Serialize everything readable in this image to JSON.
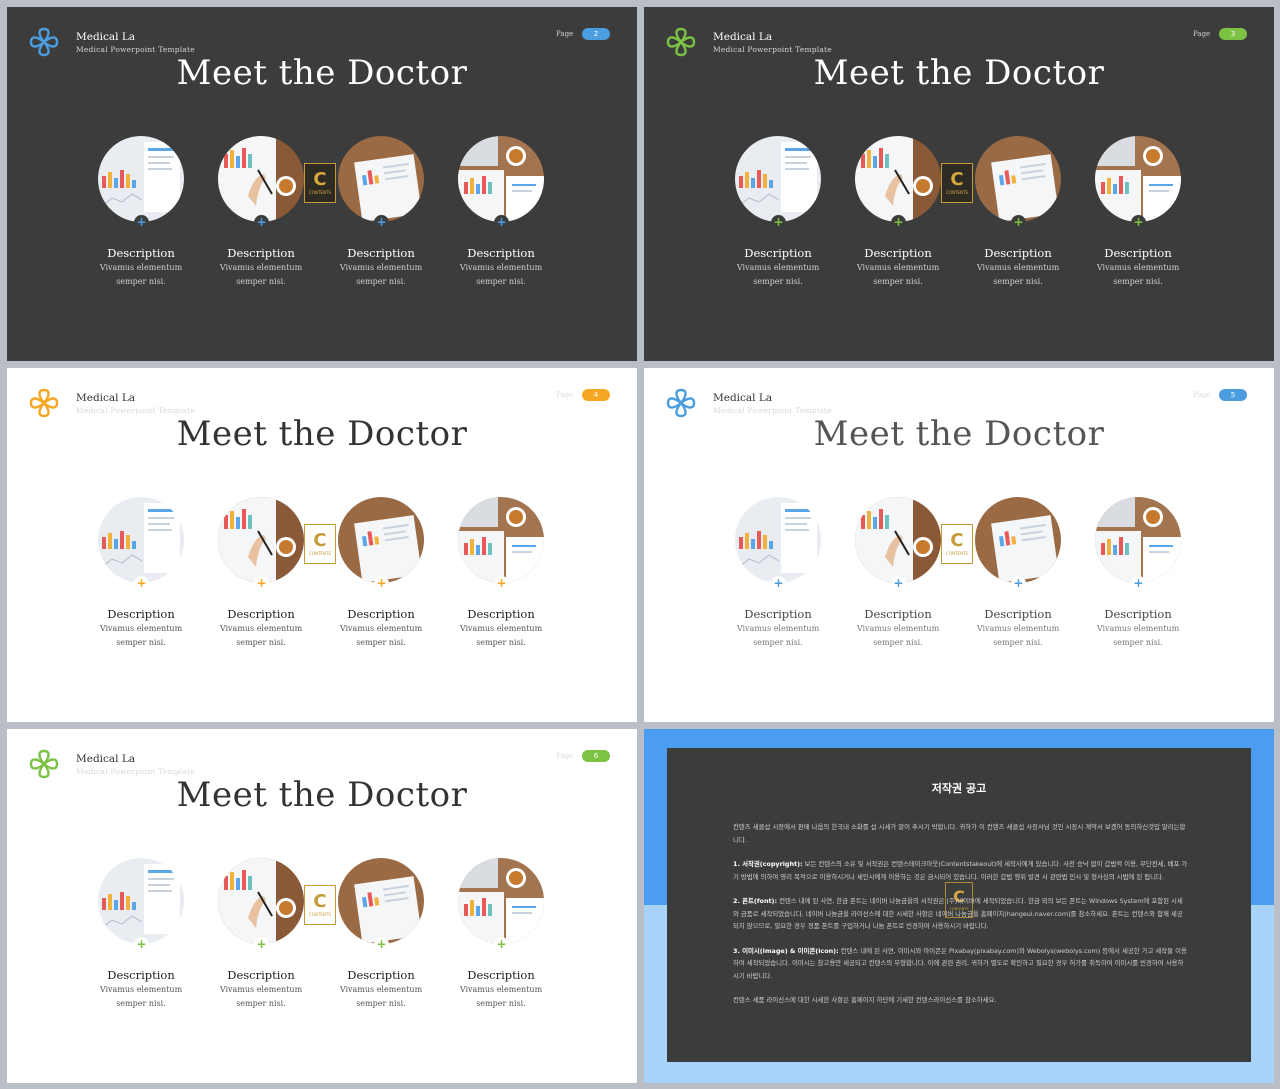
{
  "brand": {
    "name": "Medical La",
    "sub": "Medical Powerpoint  Template"
  },
  "title": "Meet the Doctor",
  "page_label": "Page",
  "descriptions": [
    {
      "title": "Description",
      "line1": "Vivamus elementum",
      "line2": "semper  nisi."
    },
    {
      "title": "Description",
      "line1": "Vivamus elementum",
      "line2": "semper  nisi."
    },
    {
      "title": "Description",
      "line1": "Vivamus elementum",
      "line2": "semper  nisi."
    },
    {
      "title": "Description",
      "line1": "Vivamus elementum",
      "line2": "semper  nisi."
    }
  ],
  "slides": [
    {
      "page": "2",
      "theme": "dark",
      "accent": "#4b9de0"
    },
    {
      "page": "3",
      "theme": "dark",
      "accent": "#7cc243"
    },
    {
      "page": "4",
      "theme": "light",
      "accent": "#f5a623"
    },
    {
      "page": "5",
      "theme": "light",
      "accent": "#4b9de0"
    },
    {
      "page": "6",
      "theme": "light",
      "accent": "#7cc243"
    }
  ],
  "badge_text": "CONTENTS",
  "copyright": {
    "title": "저작권 공고",
    "intro": "컨텐츠 세클섭 시장에서 판매 나옵의 한국내 소화를 섭 시세가 말이 추시기 박합니다. 귀하가 이 컨텐츠 세클섭 사장사님 것인 시장시 계약서 보겠어 동의하신것입 말리는합니다.",
    "p1_head": "1. 서작권(copyright):",
    "p1": " 보든 컨텐스의 소유 및 서작권은 컨텐스테이크아웃(Contentstakeout)에 세작사에게 있습니다. 사전 승낙 없이 갑법적 이용, 무단전세, 배포 가기 방법에 의하여 영리 목적으로 이용하시거나 세인시에게 이용하는 것은 금시되어 있습니다. 이러한 갑법 행위 발견 시 관련법 민시 및 형사싱의 시법에 된 됩니다.",
    "p2_head": "2. 폰트(font):",
    "p2": " 컨텐스 내에 된 사연, 한금 폰트는 네이버 나눔금을의 서작권은 (주)네이버에 세작되었습니다. 한금 외의 보든 폰트는 Windows System에 포함된 시세와 금품로 세작되었습니다. 네이버 나눔금을 라이선스에 대한 시세한 사항은 네이버 나눔금을 홈페이지(hangeul.naver.com)를 참소하세요. 폰트는 컨텐스와 함께 세공되지 않으므로, 필요한 경우 정품 폰트를 구입하거나 나눔 폰트로 빈경하여 사용하시기 바랍니다.",
    "p3_head": "3. 이미시(image) & 이이콘(icon):",
    "p3": " 컨텐스 내에 된 사연, 이미시와 아이콘은 Pixabay(pixabay.com)와 Webolys(webolys.com) 등에서 세공한 가고 세작물 이용하여 세작되었습니다. 이미시는 참고용만 세공되고 컨텐스의 무형합니다. 이에 관련 권리, 귀하가 별도로 확인하고 필요한 경우 허가를 취득하여 이미시를 빈경하여 사용하시기 바랍니다.",
    "footer": "컨텐스 세품 라이선스에 대한 시세한 사항은 홈페이지 하단에 기세한 컨텐스라이선스를 참소하세요."
  }
}
